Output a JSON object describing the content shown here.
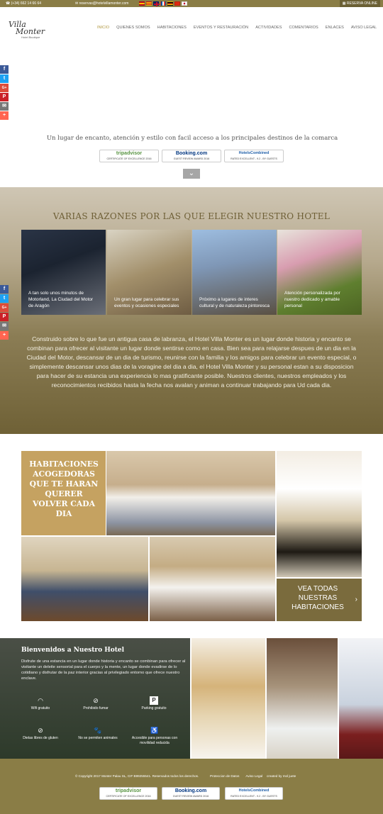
{
  "topbar": {
    "phone": "(+34) 662 14 66 64",
    "email": "reservas@hotelvillamonter.com",
    "book_now": "RESERVA ONLINE",
    "flags": [
      "spain-flag-icon",
      "catalonia-flag-icon",
      "uk-flag-icon",
      "france-flag-icon",
      "germany-flag-icon",
      "china-flag-icon",
      "japan-flag-icon"
    ]
  },
  "logo": {
    "line1": "Villa",
    "line2": "Monter",
    "sub": "Hotel Boutique"
  },
  "nav": [
    "INICIO",
    "QUIENES SOMOS",
    "HABITACIONES",
    "EVENTOS Y RESTAURACIÓN",
    "ACTIVIDADES",
    "COMENTARIOS",
    "ENLACES",
    "AVISO LEGAL"
  ],
  "share": [
    "f",
    "t",
    "G+",
    "P",
    "✉",
    "+"
  ],
  "hero": {
    "caption": "Un lugar de encanto, atención y estilo con facil acceso a los principales destinos de la comarca"
  },
  "awards": [
    {
      "brand": "tripadvisor",
      "sub": "CERTIFICATE OF EXCELLENCE 2016"
    },
    {
      "brand": "Booking.com",
      "sub": "GUEST REVIEW AWARD 2016"
    },
    {
      "brand": "HotelsCombined",
      "sub": "RATED EXCELLENT - 9.2 - BY GUESTS"
    }
  ],
  "reasons": {
    "title": "VARIAS RAZONES POR LAS QUE ELEGIR NUESTRO HOTEL",
    "items": [
      "A tan solo unos minutos de Motorland, La Ciudad del Motor de Aragón",
      "Un gran lugar para celebrar sus eventos y ocasiones especiales",
      "Próximo a lugares de interes cultural y de naturaleza pintoresca",
      "Atención personalizada por nuestro dedicado y amable personal"
    ],
    "about": "Construido sobre lo que fue un antigua casa de labranza, el Hotel Villa Monter es un lugar donde historia y encanto se combinan para ofrecer al visitante un lugar donde sentirse como en casa. Bien sea para relajarse despues de un dia en la Ciudad del Motor, descansar de un dia de turismo, reunirse con la familia y los amigos para celebrar un evento especial, o simplemente descansar unos dias de la voragine del dia a dia, el Hotel Villa Monter y su personal estan a su disposicion para hacer de su estancia una experiencia lo mas gratificante posible. Nuestros clientes, nuestros empleados y los reconocimientos recibidos hasta la fecha nos avalan y animan a continuar trabajando para Ud cada dia."
  },
  "rooms": {
    "title": "HABITACIONES ACOGEDORAS QUE TE HARAN QUERER VOLVER CADA DIA",
    "see_all": "VEA TODAS NUESTRAS HABITACIONES"
  },
  "welcome": {
    "title": "Bienvenidos a Nuestro Hotel",
    "text": "Disfrute de una estancia en un lugar donde historia y encanto se combinan para ofrecer al visitante un deleite sensorial para el cuerpo y la mente, un lugar donde evadirse de lo cotidiano y disfrutar de la paz interior gracias al privilegiado entorno que ofrece nuestro enclave.",
    "amenities": [
      {
        "icon": "wifi-icon",
        "label": "Wifi gratuito"
      },
      {
        "icon": "no-smoking-icon",
        "label": "Prohibido fumar"
      },
      {
        "icon": "parking-icon",
        "label": "Parking gratuito"
      },
      {
        "icon": "gluten-free-icon",
        "label": "Dietas libres de gluten"
      },
      {
        "icon": "no-pets-icon",
        "label": "No se permiten animales"
      },
      {
        "icon": "wheelchair-icon",
        "label": "Accesible para personas con movilidad reducida"
      }
    ]
  },
  "footer": {
    "copyright": "© Copyright 2017 Monter Palau SL, CIF B99255541. Reservados todos los derechos.",
    "links": [
      "Proteccion de Datos",
      "Aviso Legal"
    ],
    "created": "created by mol juete"
  },
  "colors": {
    "gold": "#b0963f",
    "olive": "#8a7d46",
    "brown": "#7a6b3d"
  }
}
